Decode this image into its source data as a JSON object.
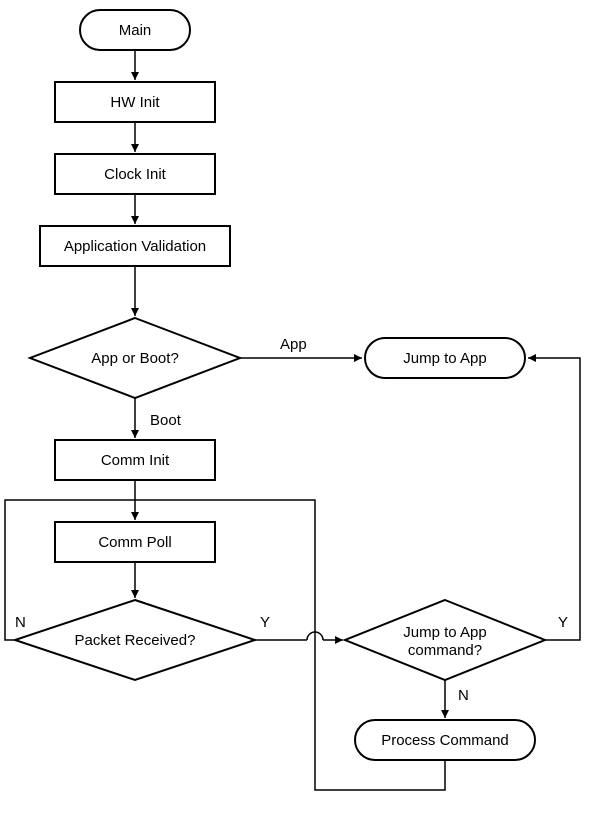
{
  "nodes": {
    "main": "Main",
    "hw_init": "HW Init",
    "clock_init": "Clock Init",
    "app_validation": "Application Validation",
    "app_or_boot": "App or Boot?",
    "jump_to_app": "Jump to App",
    "comm_init": "Comm Init",
    "comm_poll": "Comm Poll",
    "packet_received": "Packet Received?",
    "jump_cmd": "Jump to App command?",
    "process_command": "Process Command"
  },
  "edges": {
    "app": "App",
    "boot": "Boot",
    "y1": "Y",
    "n1": "N",
    "y2": "Y",
    "n2": "N"
  }
}
